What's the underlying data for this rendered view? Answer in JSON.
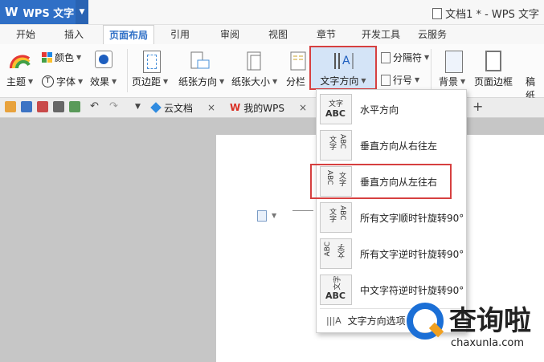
{
  "app": {
    "logo": "W",
    "name": "WPS 文字",
    "document_title": "文档1 * - WPS 文字"
  },
  "menu_tabs": [
    "开始",
    "插入",
    "页面布局",
    "引用",
    "审阅",
    "视图",
    "章节",
    "开发工具",
    "云服务"
  ],
  "active_tab": "页面布局",
  "ribbon": {
    "theme": "主题",
    "colors": "颜色",
    "fonts": "字体",
    "effects": "效果",
    "margins": "页边距",
    "orientation": "纸张方向",
    "size": "纸张大小",
    "columns": "分栏",
    "text_direction": "文字方向",
    "breaks": "分隔符",
    "line_numbers": "行号",
    "background": "背景",
    "page_border": "页面边框",
    "draft": "稿纸"
  },
  "doc_tabs": [
    {
      "label": "云文档"
    },
    {
      "label": "我的WPS"
    }
  ],
  "text_direction_menu": {
    "items": [
      {
        "label": "水平方向",
        "icon_text": "文字 ABC"
      },
      {
        "label": "垂直方向从右往左",
        "icon_text": "ABC 文字"
      },
      {
        "label": "垂直方向从左往右",
        "icon_text": "ABC 文字"
      },
      {
        "label": "所有文字顺时针旋转90°",
        "icon_text": "ABC 文字"
      },
      {
        "label": "所有文字逆时针旋转90°",
        "icon_text": "ABC 文字"
      },
      {
        "label": "中文字符逆时针旋转90°",
        "icon_text": "文字 ABC"
      }
    ],
    "options_label": "文字方向选项",
    "highlighted": "垂直方向从左往右"
  },
  "watermark": {
    "brand": "查询啦",
    "url": "chaxunla.com"
  },
  "colors": {
    "accent": "#2f6fc6",
    "highlight": "#d64040",
    "watermark": "#1b6fd6"
  }
}
